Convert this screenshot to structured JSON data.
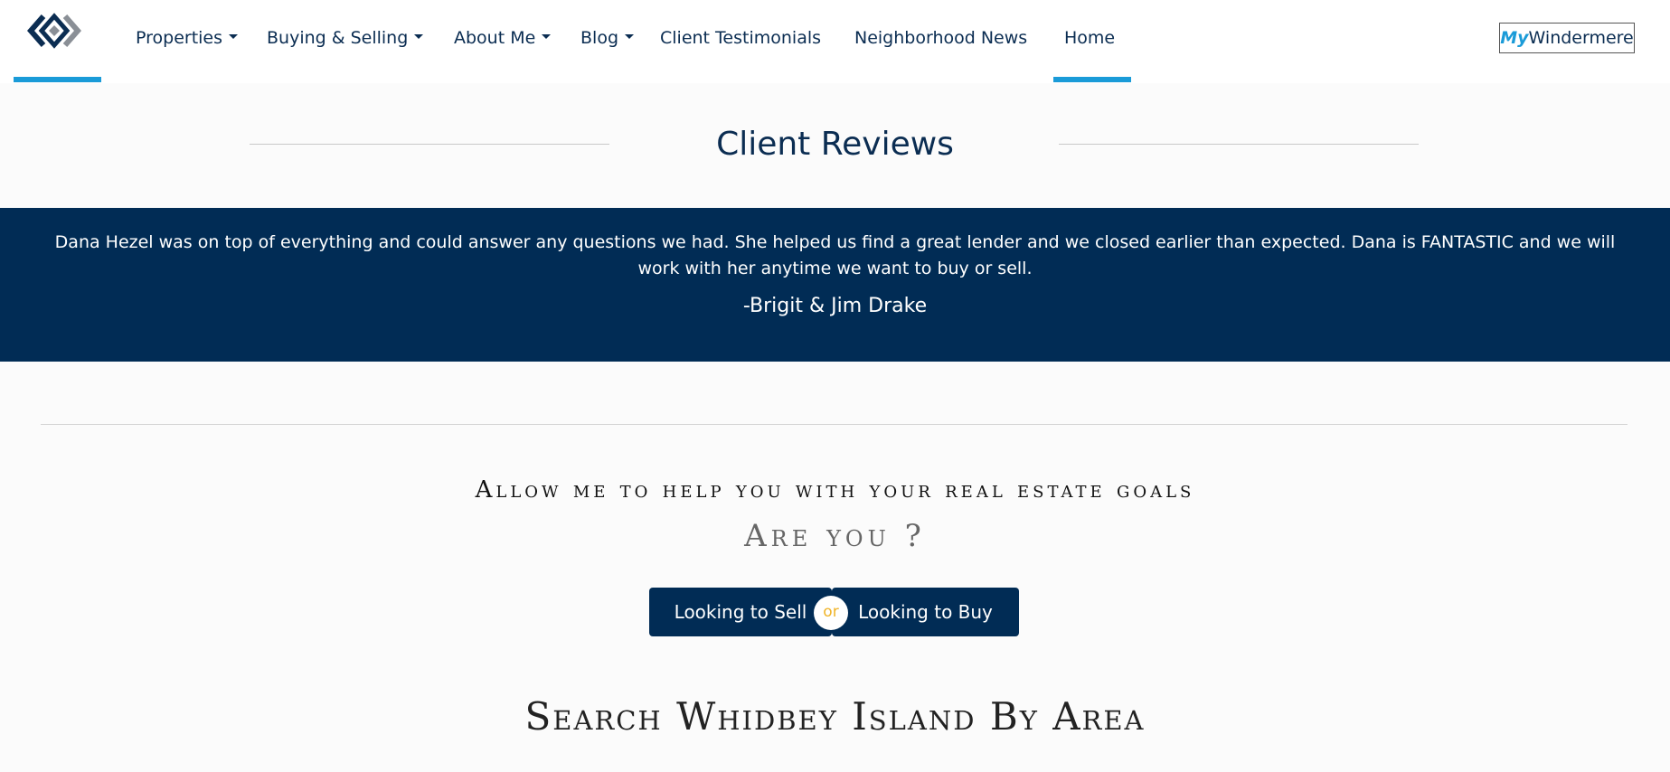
{
  "header": {
    "logo_icon": "windermere-logo-icon",
    "nav": [
      {
        "label": "Properties",
        "has_dropdown": true
      },
      {
        "label": "Buying & Selling",
        "has_dropdown": true
      },
      {
        "label": "About Me",
        "has_dropdown": true
      },
      {
        "label": "Blog",
        "has_dropdown": true
      },
      {
        "label": "Client Testimonials",
        "has_dropdown": false
      },
      {
        "label": "Neighborhood News",
        "has_dropdown": false
      },
      {
        "label": "Home",
        "has_dropdown": false,
        "active": true
      }
    ],
    "mywindermere": {
      "my": "My",
      "rest": "Windermere"
    }
  },
  "reviews": {
    "title": "Client Reviews",
    "quote": "Dana Hezel was on top of everything and could answer any questions we had. She helped us find a great lender and we closed earlier than expected. Dana is FANTASTIC and we will work with her anytime we want to buy or sell.",
    "author": "-Brigit & Jim Drake"
  },
  "cta": {
    "heading": "Allow me to help you with your real estate goals",
    "question": "Are you ?",
    "sell_label": "Looking to Sell",
    "or_label": "or",
    "buy_label": "Looking to Buy"
  },
  "search": {
    "title": "Search Whidbey Island By Area"
  },
  "colors": {
    "navy": "#012c55",
    "accent_blue": "#1a9bd8",
    "or_gold": "#f0b429"
  }
}
